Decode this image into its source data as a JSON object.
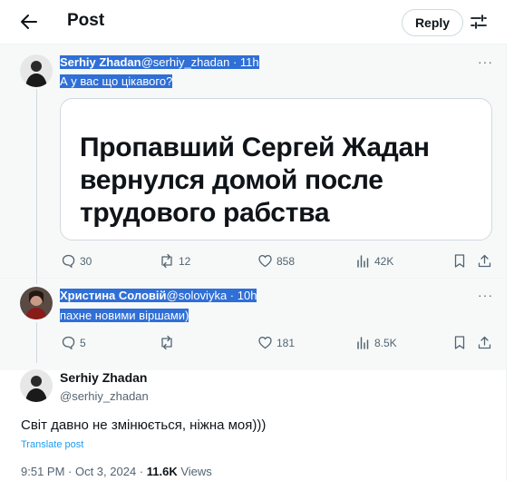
{
  "header": {
    "title": "Post",
    "reply_label": "Reply"
  },
  "tweet1": {
    "name": "Serhiy Zhadan",
    "handle": "@serhiy_zhadan",
    "sep": " · ",
    "time": "11h",
    "text": "А у вас що цікавого?",
    "card_lines": [
      "Пропавший Сергей Жадан",
      "вернулся домой после",
      "трудового рабства"
    ],
    "stats": {
      "replies": "30",
      "reposts": "12",
      "likes": "858",
      "views": "42K"
    }
  },
  "tweet2": {
    "name": "Христина Соловій",
    "handle": "@soloviyka",
    "sep": " · ",
    "time": "10h",
    "text": "пахне новими віршами)",
    "stats": {
      "replies": "5",
      "reposts": "",
      "likes": "181",
      "views": "8.5K"
    }
  },
  "main": {
    "name": "Serhiy Zhadan",
    "handle": "@serhiy_zhadan",
    "text": "Світ давно не змінюється, ніжна моя)))",
    "translate": "Translate post",
    "time": "9:51 PM · Oct 3, 2024 · ",
    "views_count": "11.6K",
    "views_label": " Views"
  },
  "icons": [
    "back-arrow-icon",
    "adjust-icon",
    "more-icon",
    "reply-icon",
    "repost-icon",
    "like-icon",
    "views-icon",
    "bookmark-icon",
    "share-icon"
  ]
}
